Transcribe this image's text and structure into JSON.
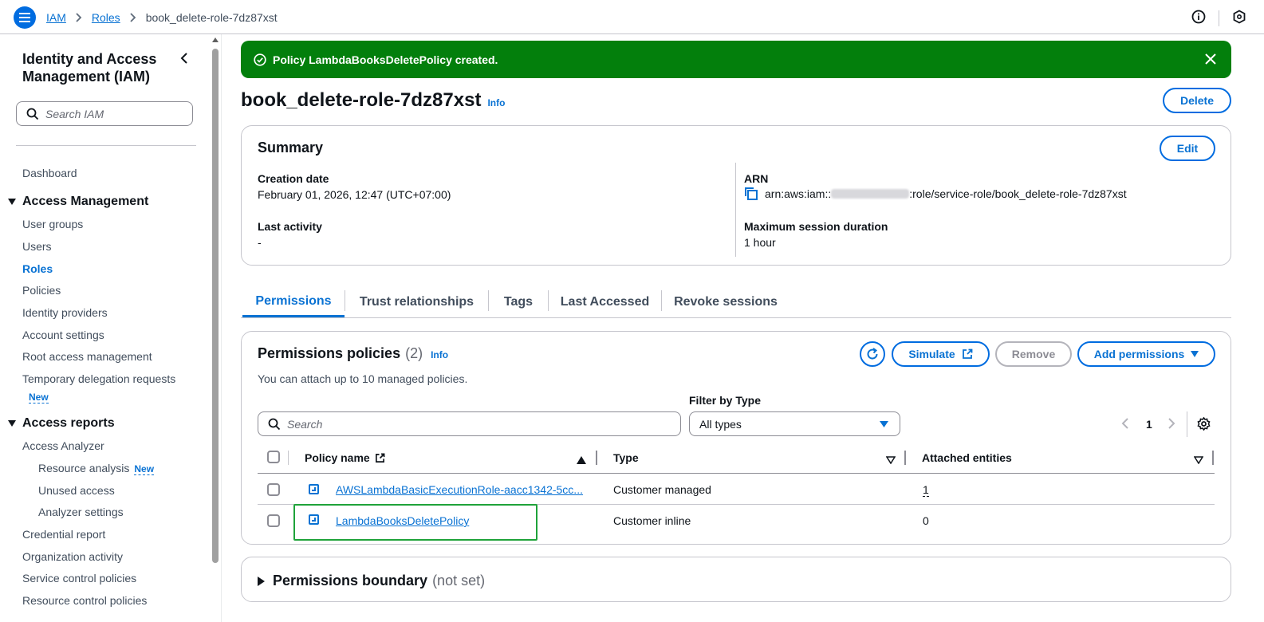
{
  "breadcrumb": {
    "items": [
      "IAM",
      "Roles"
    ],
    "current": "book_delete-role-7dz87xst"
  },
  "sidebar": {
    "title": "Identity and Access Management (IAM)",
    "search_placeholder": "Search IAM",
    "dashboard": "Dashboard",
    "access_management": {
      "heading": "Access Management",
      "items": [
        "User groups",
        "Users",
        "Roles",
        "Policies",
        "Identity providers",
        "Account settings",
        "Root access management",
        "Temporary delegation requests"
      ],
      "new_badge": "New"
    },
    "access_reports": {
      "heading": "Access reports",
      "analyzer": "Access Analyzer",
      "analyzer_items": [
        "Resource analysis",
        "Unused access",
        "Analyzer settings"
      ],
      "new_badge": "New",
      "items": [
        "Credential report",
        "Organization activity",
        "Service control policies",
        "Resource control policies"
      ]
    }
  },
  "flash": {
    "message": "Policy LambdaBooksDeletePolicy created."
  },
  "page": {
    "title": "book_delete-role-7dz87xst",
    "info": "Info",
    "delete_label": "Delete"
  },
  "summary": {
    "title": "Summary",
    "edit_label": "Edit",
    "creation_date_label": "Creation date",
    "creation_date": "February 01, 2026, 12:47 (UTC+07:00)",
    "last_activity_label": "Last activity",
    "last_activity": "-",
    "arn_label": "ARN",
    "arn_prefix": "arn:aws:iam::",
    "arn_suffix": ":role/service-role/book_delete-role-7dz87xst",
    "max_session_label": "Maximum session duration",
    "max_session": "1 hour"
  },
  "tabs": [
    "Permissions",
    "Trust relationships",
    "Tags",
    "Last Accessed",
    "Revoke sessions"
  ],
  "permissions": {
    "title": "Permissions policies",
    "count": "(2)",
    "info": "Info",
    "description": "You can attach up to 10 managed policies.",
    "simulate_label": "Simulate",
    "remove_label": "Remove",
    "add_label": "Add permissions",
    "filter_label": "Filter by Type",
    "search_placeholder": "Search",
    "filter_value": "All types",
    "page_number": "1",
    "columns": [
      "Policy name",
      "Type",
      "Attached entities"
    ],
    "rows": [
      {
        "name": "AWSLambdaBasicExecutionRole-aacc1342-5cc...",
        "type": "Customer managed",
        "entities": "1"
      },
      {
        "name": "LambdaBooksDeletePolicy",
        "type": "Customer inline",
        "entities": "0"
      }
    ]
  },
  "boundary": {
    "title": "Permissions boundary",
    "status": "(not set)"
  }
}
